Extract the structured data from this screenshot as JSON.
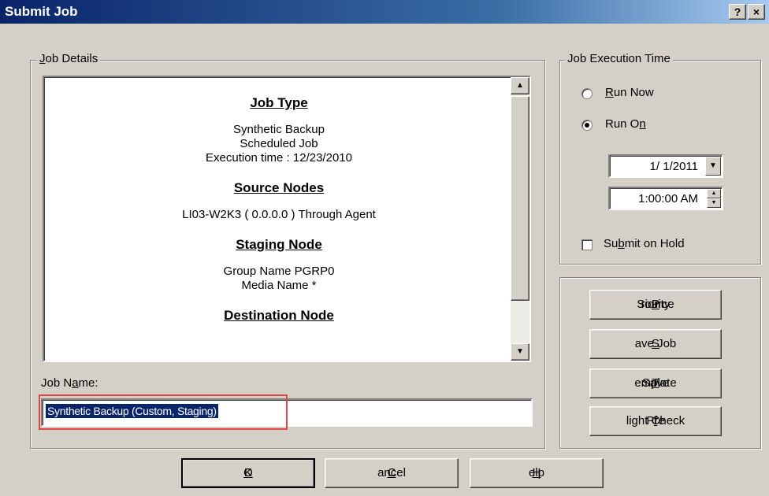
{
  "window": {
    "title": "Submit Job",
    "help_glyph": "?",
    "close_glyph": "×"
  },
  "job_details": {
    "legend_pre": "",
    "legend_ul": "J",
    "legend_post": "ob Details",
    "sections": {
      "job_type": {
        "title": "Job Type",
        "lines": [
          "Synthetic Backup",
          "Scheduled Job",
          "Execution time :  12/23/2010"
        ]
      },
      "source_nodes": {
        "title": "Source Nodes",
        "lines": [
          "LI03-W2K3 ( 0.0.0.0 )    Through Agent"
        ]
      },
      "staging_node": {
        "title": "Staging Node",
        "lines": [
          "Group Name   PGRP0",
          "Media Name   *"
        ]
      },
      "destination_node": {
        "title": "Destination Node"
      }
    },
    "scroll_up": "▲",
    "scroll_down": "▼"
  },
  "job_name": {
    "label_pre": "Job N",
    "label_ul": "a",
    "label_post": "me:",
    "value": "Synthetic Backup (Custom, Staging)"
  },
  "execution_time": {
    "legend": "Job Execution Time",
    "run_now": {
      "pre": "",
      "ul": "R",
      "post": "un Now",
      "selected": false
    },
    "run_on": {
      "pre": "Run O",
      "ul": "n",
      "post": "",
      "selected": true
    },
    "date": "1/  1/2011",
    "time": "1:00:00 AM",
    "dropdown_glyph": "▼",
    "spin_up": "▲",
    "spin_down": "▼",
    "submit_on_hold": {
      "pre": "Su",
      "ul": "b",
      "post": "mit on Hold",
      "checked": false
    }
  },
  "side_buttons": {
    "source_priority": {
      "pre": "Source ",
      "ul": "P",
      "post": "riority"
    },
    "save_job": {
      "pre": "",
      "ul": "S",
      "post": "ave Job"
    },
    "save_template": {
      "pre": "Save ",
      "ul": "T",
      "post": "emplate"
    },
    "preflight_check": {
      "pre": "Pre",
      "ul": "f",
      "post": "light Check"
    }
  },
  "bottom_buttons": {
    "ok": {
      "pre": "",
      "ul": "O",
      "post": "K"
    },
    "cancel": {
      "pre": "",
      "ul": "C",
      "post": "ancel"
    },
    "help": {
      "pre": "",
      "ul": "H",
      "post": "elp"
    }
  },
  "colors": {
    "dialog_bg": "#d4d0c8",
    "titlebar_start": "#0a246a",
    "titlebar_end": "#a6caf0",
    "selection_bg": "#0a246a",
    "highlight_outline": "#e0464a"
  }
}
